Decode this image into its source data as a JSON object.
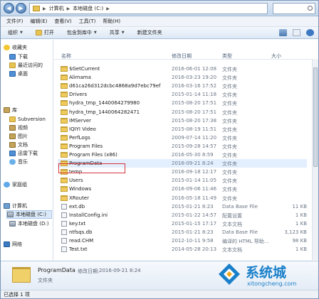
{
  "address": {
    "path": [
      "计算机",
      "本地磁盘 (C:)"
    ]
  },
  "menu": [
    "文件(F)",
    "编辑(E)",
    "查看(V)",
    "工具(T)",
    "帮助(H)"
  ],
  "toolbar": {
    "organize": "组织",
    "open": "打开",
    "include": "包含到库中",
    "share": "共享",
    "new_folder": "新建文件夹"
  },
  "sidebar": {
    "favorites": "收藏夹",
    "favorites_items": [
      "下载",
      "最近访问的",
      "桌面"
    ],
    "libraries": "库",
    "libraries_items": [
      "Subversion",
      "视频",
      "图片",
      "文档",
      "迅雷下载",
      "音乐"
    ],
    "homegroup": "家庭组",
    "computer": "计算机",
    "computer_items": [
      "本地磁盘 (C:)",
      "本地磁盘 (D:)"
    ],
    "network": "网络"
  },
  "columns": {
    "name": "名称",
    "date": "修改日期",
    "type": "类型",
    "size": "大小"
  },
  "files": [
    {
      "name": "$GetCurrent",
      "date": "2016-06-01 12:08",
      "type": "文件夹",
      "size": "",
      "kind": "folder"
    },
    {
      "name": "Alimama",
      "date": "2016-03-23 19:20",
      "type": "文件夹",
      "size": "",
      "kind": "folder"
    },
    {
      "name": "d61ca26d312dcbc4868a9d7ebc79ef",
      "date": "2016-03-16 17:52",
      "type": "文件夹",
      "size": "",
      "kind": "folder"
    },
    {
      "name": "Drivers",
      "date": "2015-01-14 11:18",
      "type": "文件夹",
      "size": "",
      "kind": "folder"
    },
    {
      "name": "hydra_tmp_1440064279980",
      "date": "2015-08-20 17:51",
      "type": "文件夹",
      "size": "",
      "kind": "folder"
    },
    {
      "name": "hydra_tmp_1440064282471",
      "date": "2015-08-20 17:51",
      "type": "文件夹",
      "size": "",
      "kind": "folder"
    },
    {
      "name": "IMServer",
      "date": "2015-08-20 17:38",
      "type": "文件夹",
      "size": "",
      "kind": "folder"
    },
    {
      "name": "IQIYI Video",
      "date": "2015-08-19 11:51",
      "type": "文件夹",
      "size": "",
      "kind": "folder"
    },
    {
      "name": "PerfLogs",
      "date": "2009-07-14 11:20",
      "type": "文件夹",
      "size": "",
      "kind": "folder"
    },
    {
      "name": "Program Files",
      "date": "2015-09-28 14:57",
      "type": "文件夹",
      "size": "",
      "kind": "folder"
    },
    {
      "name": "Program Files (x86)",
      "date": "2016-05-30 8:59",
      "type": "文件夹",
      "size": "",
      "kind": "folder"
    },
    {
      "name": "ProgramData",
      "date": "2016-09-21 8:24",
      "type": "文件夹",
      "size": "",
      "kind": "folder",
      "selected": true
    },
    {
      "name": "temp",
      "date": "2016-09-18 12:17",
      "type": "文件夹",
      "size": "",
      "kind": "folder"
    },
    {
      "name": "Users",
      "date": "2015-01-14 11:05",
      "type": "文件夹",
      "size": "",
      "kind": "folder"
    },
    {
      "name": "Windows",
      "date": "2016-09-06 11:46",
      "type": "文件夹",
      "size": "",
      "kind": "folder"
    },
    {
      "name": "XRouter",
      "date": "2016-05-18 11:49",
      "type": "文件夹",
      "size": "",
      "kind": "folder"
    },
    {
      "name": "ext.db",
      "date": "2015-01-21 8:23",
      "type": "Data Base File",
      "size": "11 KB",
      "kind": "file"
    },
    {
      "name": "InstallConfig.ini",
      "date": "2015-01-22 14:57",
      "type": "配置设置",
      "size": "1 KB",
      "kind": "file"
    },
    {
      "name": "key.txt",
      "date": "2015-01-15 17:17",
      "type": "文本文档",
      "size": "1 KB",
      "kind": "file"
    },
    {
      "name": "ntfsqs.db",
      "date": "2015-01-21 8:23",
      "type": "Data Base File",
      "size": "3,123 KB",
      "kind": "file"
    },
    {
      "name": "read.CHM",
      "date": "2012-10-11 9:58",
      "type": "编译的 HTML 帮助...",
      "size": "98 KB",
      "kind": "file"
    },
    {
      "name": "Test.txt",
      "date": "2014-05-28 20:13",
      "type": "文本文档",
      "size": "1 KB",
      "kind": "file"
    }
  ],
  "details": {
    "name": "ProgramData",
    "modified_label": "修改日期:",
    "modified": "2016-09-21 8:24",
    "type": "文件夹"
  },
  "status": "已选择 1 项",
  "watermark": {
    "title": "系统城",
    "url": "xitongcheng.com"
  }
}
